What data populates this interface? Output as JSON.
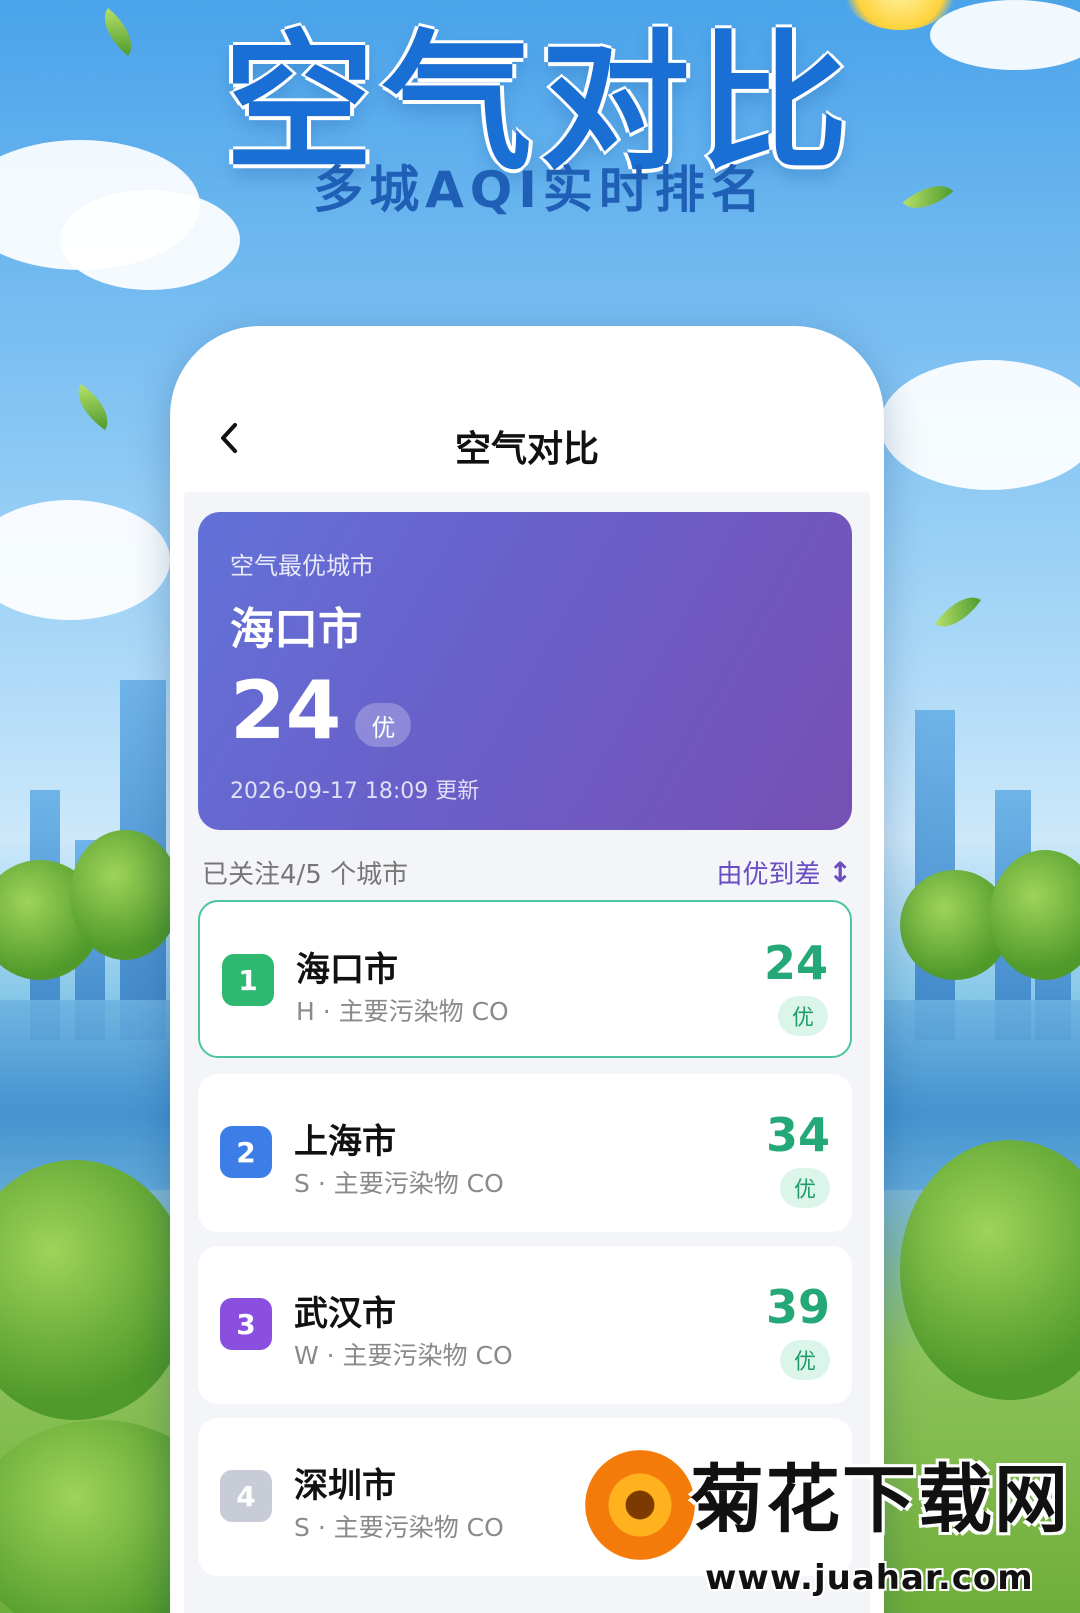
{
  "promo": {
    "title": "空气对比",
    "subtitle": "多城AQI实时排名"
  },
  "nav": {
    "back_icon": "chevron-left-icon",
    "title": "空气对比"
  },
  "best": {
    "label": "空气最优城市",
    "city": "海口市",
    "aqi": "24",
    "level": "优",
    "updated": "2026-09-17 18:09 更新"
  },
  "list": {
    "followed": "已关注4/5 个城市",
    "sort_label": "由优到差",
    "sort_icon": "↕",
    "items": [
      {
        "rank": "1",
        "city": "海口市",
        "meta": "H · 主要污染物 CO",
        "aqi": "24",
        "level": "优",
        "rank_color": "#2fb86f"
      },
      {
        "rank": "2",
        "city": "上海市",
        "meta": "S · 主要污染物 CO",
        "aqi": "34",
        "level": "优",
        "rank_color": "#3d7de8"
      },
      {
        "rank": "3",
        "city": "武汉市",
        "meta": "W · 主要污染物 CO",
        "aqi": "39",
        "level": "优",
        "rank_color": "#8a4fdf"
      },
      {
        "rank": "4",
        "city": "深圳市",
        "meta": "S · 主要污染物 CO",
        "aqi": "",
        "level": "",
        "rank_color": "#c8ccd6"
      }
    ]
  },
  "watermark": {
    "title": "菊花下载网",
    "url": "www.juahar.com"
  },
  "colors": {
    "best_gradient_start": "#6272d8",
    "best_gradient_end": "#7650b4",
    "aqi_good": "#25a878",
    "sort_accent": "#6a4ec1"
  }
}
